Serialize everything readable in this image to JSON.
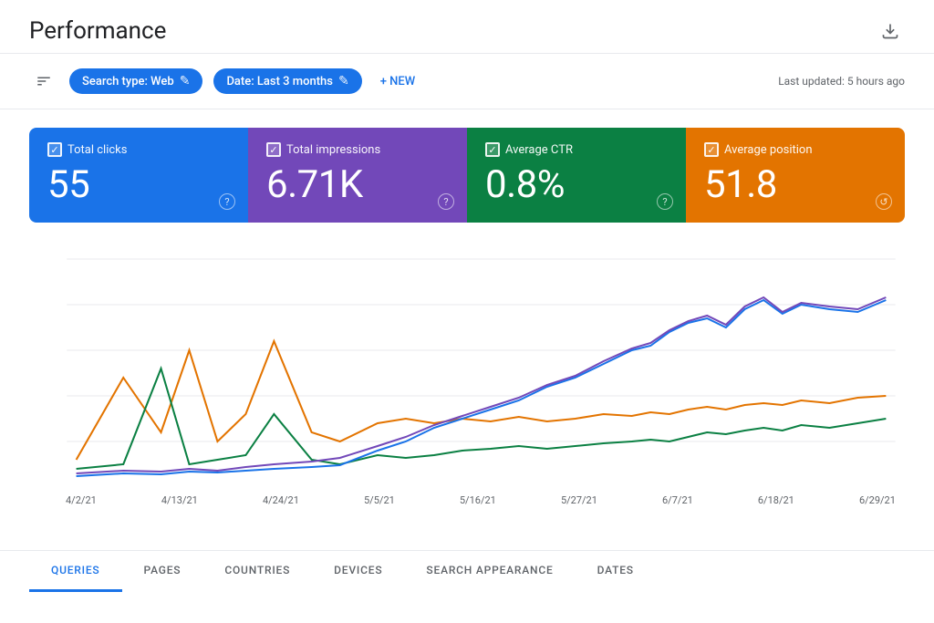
{
  "header": {
    "title": "Performance",
    "download_icon": "⬇"
  },
  "toolbar": {
    "filter_icon": "≡",
    "search_type_chip": "Search type: Web",
    "date_chip": "Date: Last 3 months",
    "edit_icon": "✎",
    "new_button": "+ NEW",
    "last_updated": "Last updated: 5 hours ago"
  },
  "metrics": [
    {
      "id": "total-clicks",
      "label": "Total clicks",
      "value": "55",
      "color": "blue",
      "checked": true
    },
    {
      "id": "total-impressions",
      "label": "Total impressions",
      "value": "6.71K",
      "color": "purple",
      "checked": true
    },
    {
      "id": "average-ctr",
      "label": "Average CTR",
      "value": "0.8%",
      "color": "teal",
      "checked": true
    },
    {
      "id": "average-position",
      "label": "Average position",
      "value": "51.8",
      "color": "orange",
      "checked": true
    }
  ],
  "chart": {
    "dates": [
      "4/2/21",
      "4/13/21",
      "4/24/21",
      "5/5/21",
      "5/16/21",
      "5/27/21",
      "6/7/21",
      "6/18/21",
      "6/29/21"
    ],
    "colors": {
      "clicks": "#e37400",
      "impressions": "#1a73e8",
      "ctr": "#0b8043",
      "position": "#7248b9"
    }
  },
  "bottom_tabs": [
    {
      "label": "QUERIES",
      "active": true
    },
    {
      "label": "PAGES",
      "active": false
    },
    {
      "label": "COUNTRIES",
      "active": false
    },
    {
      "label": "DEVICES",
      "active": false
    },
    {
      "label": "SEARCH APPEARANCE",
      "active": false
    },
    {
      "label": "DATES",
      "active": false
    }
  ]
}
